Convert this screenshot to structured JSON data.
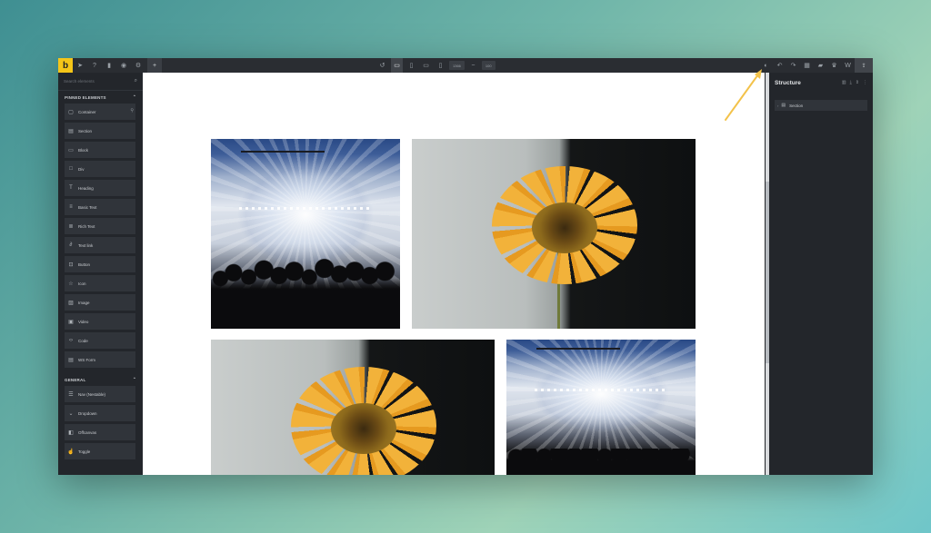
{
  "app": {
    "logo_letter": "b",
    "brand_color": "#f5c518"
  },
  "topbar": {
    "width_value": "1366",
    "zoom_value": "100"
  },
  "left_panel": {
    "search_placeholder": "Search elements",
    "sections": [
      {
        "title": "PINNED ELEMENTS",
        "items": [
          {
            "label": "Container",
            "icon": "container-icon"
          },
          {
            "label": "Section",
            "icon": "section-icon"
          },
          {
            "label": "Block",
            "icon": "block-icon"
          },
          {
            "label": "Div",
            "icon": "div-icon"
          },
          {
            "label": "Heading",
            "icon": "heading-icon"
          },
          {
            "label": "Basic Text",
            "icon": "text-icon"
          },
          {
            "label": "Rich Text",
            "icon": "rich-text-icon"
          },
          {
            "label": "Text link",
            "icon": "link-icon"
          },
          {
            "label": "Button",
            "icon": "button-icon"
          },
          {
            "label": "Icon",
            "icon": "star-icon"
          },
          {
            "label": "Image",
            "icon": "image-icon"
          },
          {
            "label": "Video",
            "icon": "video-icon"
          },
          {
            "label": "Code",
            "icon": "code-icon"
          },
          {
            "label": "WS Form",
            "icon": "form-icon"
          }
        ]
      },
      {
        "title": "GENERAL",
        "items": [
          {
            "label": "Nav (Nestable)",
            "icon": "nav-icon"
          },
          {
            "label": "Dropdown",
            "icon": "dropdown-icon"
          },
          {
            "label": "Offcanvas",
            "icon": "offcanvas-icon"
          },
          {
            "label": "Toggle",
            "icon": "toggle-icon"
          }
        ]
      }
    ]
  },
  "right_panel": {
    "title": "Structure",
    "tree": [
      {
        "label": "Section",
        "icon": "section-icon"
      }
    ]
  }
}
